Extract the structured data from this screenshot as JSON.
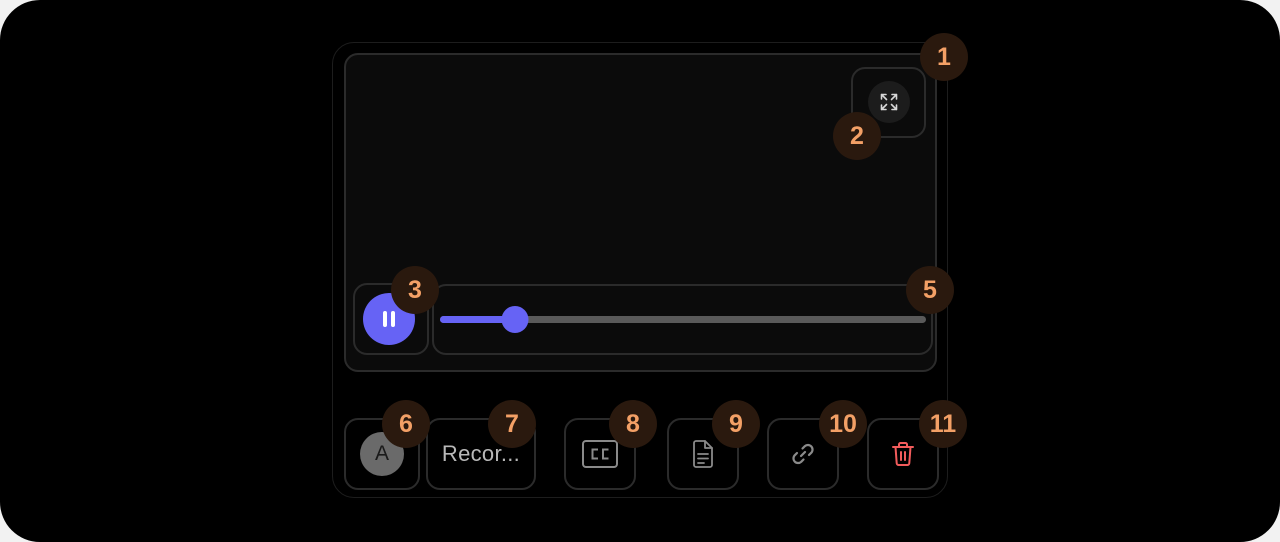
{
  "colors": {
    "accent": "#6663f5",
    "badge_text": "#f3a066",
    "badge_bg": "#2a190e",
    "delete_icon": "#f25c5c",
    "icon_gray": "#8a8a8a"
  },
  "player": {
    "progress": 0.155,
    "fullscreen_icon": "expand-icon",
    "play_state_icon": "pause-icon"
  },
  "toolbar": {
    "avatar_initial": "A",
    "recording_name": "Recor...",
    "captions_icon": "closed-captions-icon",
    "transcript_icon": "document-icon",
    "link_icon": "link-icon",
    "delete_icon": "trash-icon"
  },
  "badges": [
    "1",
    "2",
    "3",
    "5",
    "6",
    "7",
    "8",
    "9",
    "10",
    "11"
  ]
}
